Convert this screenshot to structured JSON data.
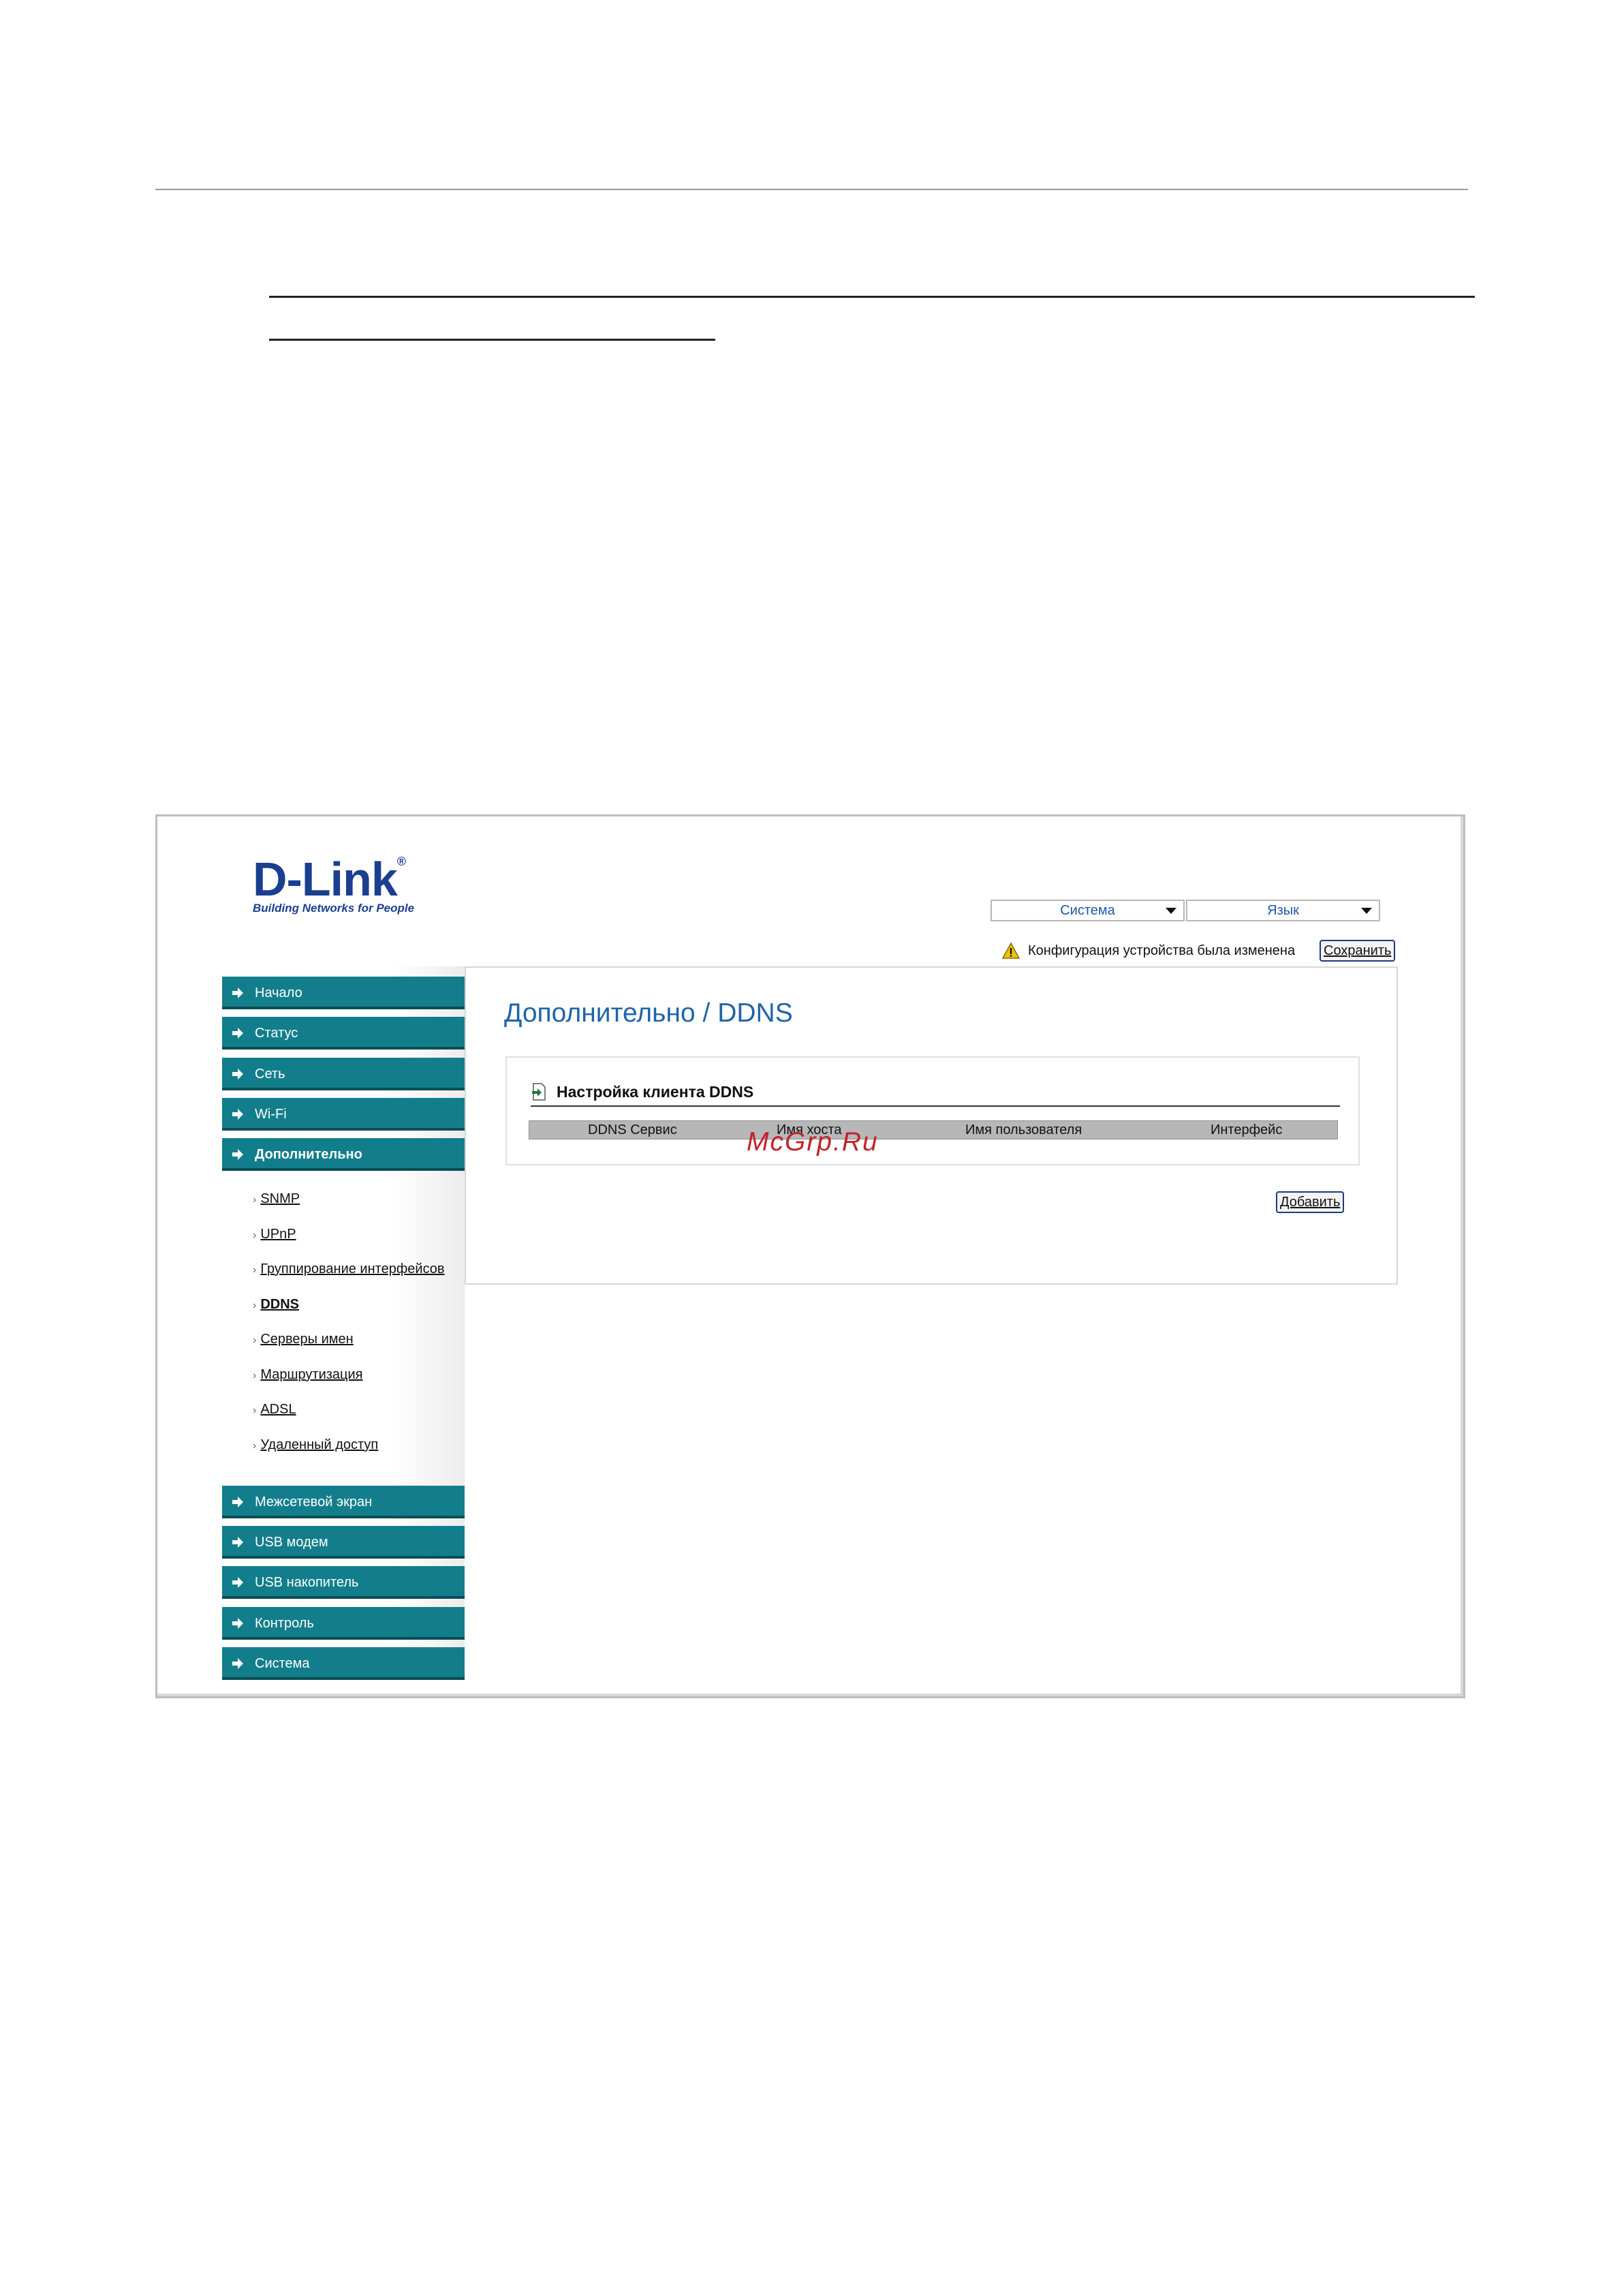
{
  "header": {
    "logo_main": "D-Link",
    "logo_reg": "®",
    "logo_sub": "Building Networks for People",
    "system_menu": "Система",
    "language_menu": "Язык",
    "notice_text": "Конфигурация устройства была изменена",
    "save_label": "Сохранить"
  },
  "sidebar": {
    "items": [
      {
        "label": "Начало"
      },
      {
        "label": "Статус"
      },
      {
        "label": "Сеть"
      },
      {
        "label": "Wi-Fi"
      },
      {
        "label": "Дополнительно"
      },
      {
        "label": "Межсетевой экран"
      },
      {
        "label": "USB модем"
      },
      {
        "label": "USB накопитель"
      },
      {
        "label": "Контроль"
      },
      {
        "label": "Система"
      }
    ],
    "sub_items": [
      {
        "label": "SNMP"
      },
      {
        "label": "UPnP"
      },
      {
        "label": "Группирование интерфейсов"
      },
      {
        "label": "DDNS"
      },
      {
        "label": "Серверы имен"
      },
      {
        "label": "Маршрутизация"
      },
      {
        "label": "ADSL"
      },
      {
        "label": "Удаленный доступ"
      }
    ],
    "sub_chevron": "›"
  },
  "main": {
    "title": "Дополнительно /  DDNS",
    "panel_title": "Настройка клиента DDNS",
    "columns": [
      "DDNS Сервис",
      "Имя хоста",
      "Имя пользователя",
      "Интерфейс"
    ],
    "add_label": "Добавить"
  },
  "watermark": "McGrp.Ru",
  "colors": {
    "nav_bg": "#137e8b",
    "title": "#1f64a8",
    "logo": "#1b3f8f"
  }
}
